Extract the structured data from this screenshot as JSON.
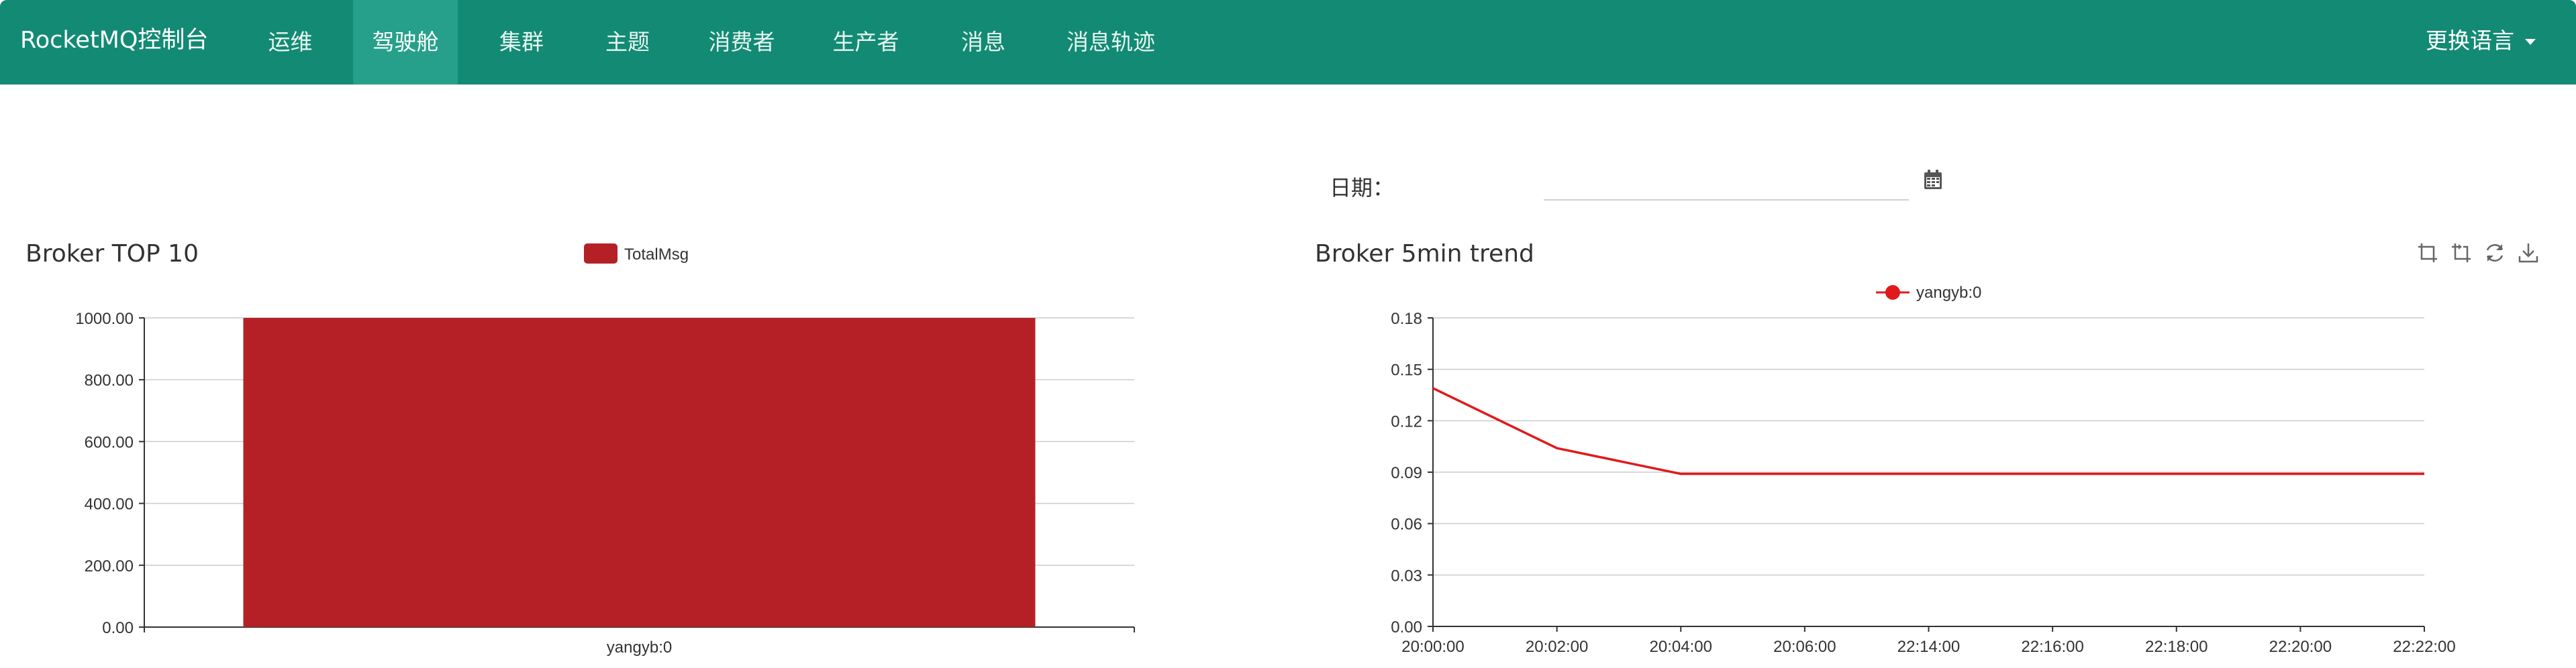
{
  "app": {
    "title": "RocketMQ控制台"
  },
  "nav": {
    "items": [
      {
        "label": "运维"
      },
      {
        "label": "驾驶舱"
      },
      {
        "label": "集群"
      },
      {
        "label": "主题"
      },
      {
        "label": "消费者"
      },
      {
        "label": "生产者"
      },
      {
        "label": "消息"
      },
      {
        "label": "消息轨迹"
      }
    ],
    "active": "驾驶舱",
    "language_label": "更换语言"
  },
  "date_filter": {
    "label": "日期：",
    "value": ""
  },
  "colors": {
    "navbar": "#138a74",
    "nav_active": "#26a08a",
    "bar": "#b52027",
    "line": "#e0191c"
  },
  "icons": {
    "calendar": "calendar-icon",
    "toolbox": [
      "zoom-icon",
      "zoom-reset-icon",
      "restore-icon",
      "save-image-icon"
    ]
  },
  "chart_data": [
    {
      "type": "bar",
      "title": "Broker TOP 10",
      "categories": [
        "yangyb:0"
      ],
      "series": [
        {
          "name": "TotalMsg",
          "values": [
            1000
          ]
        }
      ],
      "ylim": [
        0,
        1000
      ],
      "yticks": [
        "0.00",
        "200.00",
        "400.00",
        "600.00",
        "800.00",
        "1000.00"
      ],
      "grid": true,
      "legend": "top-center"
    },
    {
      "type": "line",
      "title": "Broker 5min trend",
      "x": [
        "20:00:00",
        "20:02:00",
        "20:04:00",
        "20:06:00",
        "22:14:00",
        "22:16:00",
        "22:18:00",
        "22:20:00",
        "22:22:00"
      ],
      "series": [
        {
          "name": "yangyb:0",
          "values": [
            0.139,
            0.104,
            0.089,
            0.089,
            0.089,
            0.089,
            0.089,
            0.089,
            0.089
          ]
        }
      ],
      "ylim": [
        0,
        0.18
      ],
      "yticks": [
        "0.00",
        "0.03",
        "0.06",
        "0.09",
        "0.12",
        "0.15",
        "0.18"
      ],
      "grid": true,
      "legend": "top-center"
    }
  ]
}
